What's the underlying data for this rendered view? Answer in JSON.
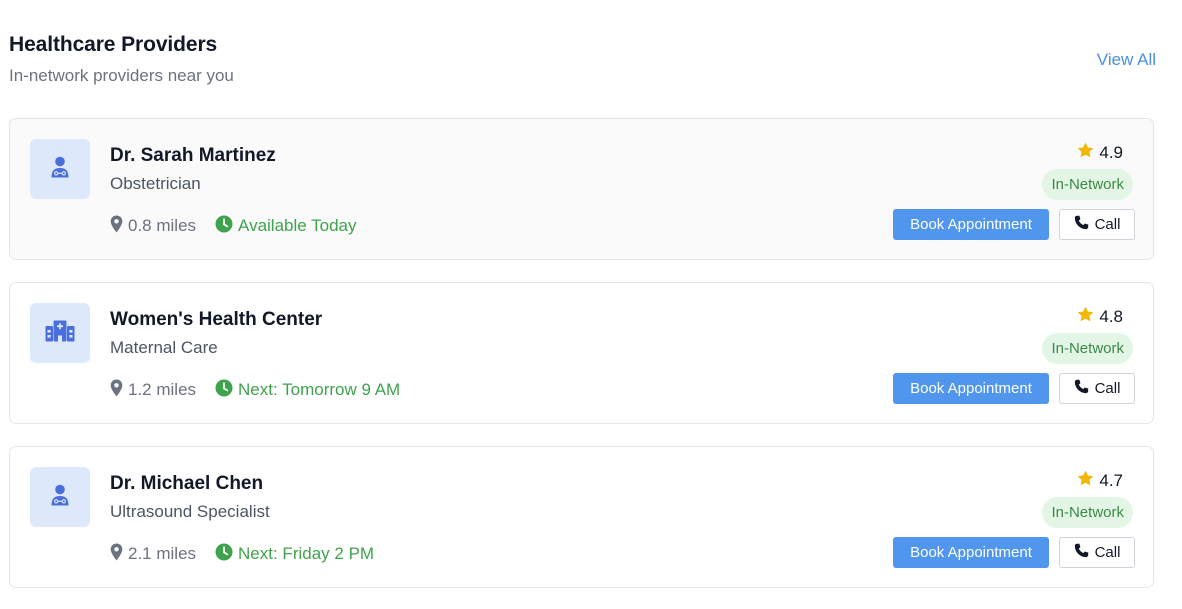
{
  "header": {
    "title": "Healthcare Providers",
    "subtitle": "In-network providers near you",
    "view_all_label": "View All"
  },
  "colors": {
    "accent": "#4f96ec",
    "available": "#3fa34d",
    "badge_bg": "#e3f6e6",
    "star": "#f2b705"
  },
  "providers": [
    {
      "name": "Dr. Sarah Martinez",
      "specialty": "Obstetrician",
      "icon": "doctor-icon",
      "distance": "0.8 miles",
      "availability": "Available Today",
      "rating": "4.9",
      "network": "In-Network",
      "book_label": "Book Appointment",
      "call_label": "Call"
    },
    {
      "name": "Women's Health Center",
      "specialty": "Maternal Care",
      "icon": "hospital-icon",
      "distance": "1.2 miles",
      "availability": "Next: Tomorrow 9 AM",
      "rating": "4.8",
      "network": "In-Network",
      "book_label": "Book Appointment",
      "call_label": "Call"
    },
    {
      "name": "Dr. Michael Chen",
      "specialty": "Ultrasound Specialist",
      "icon": "doctor-icon",
      "distance": "2.1 miles",
      "availability": "Next: Friday 2 PM",
      "rating": "4.7",
      "network": "In-Network",
      "book_label": "Book Appointment",
      "call_label": "Call"
    }
  ]
}
